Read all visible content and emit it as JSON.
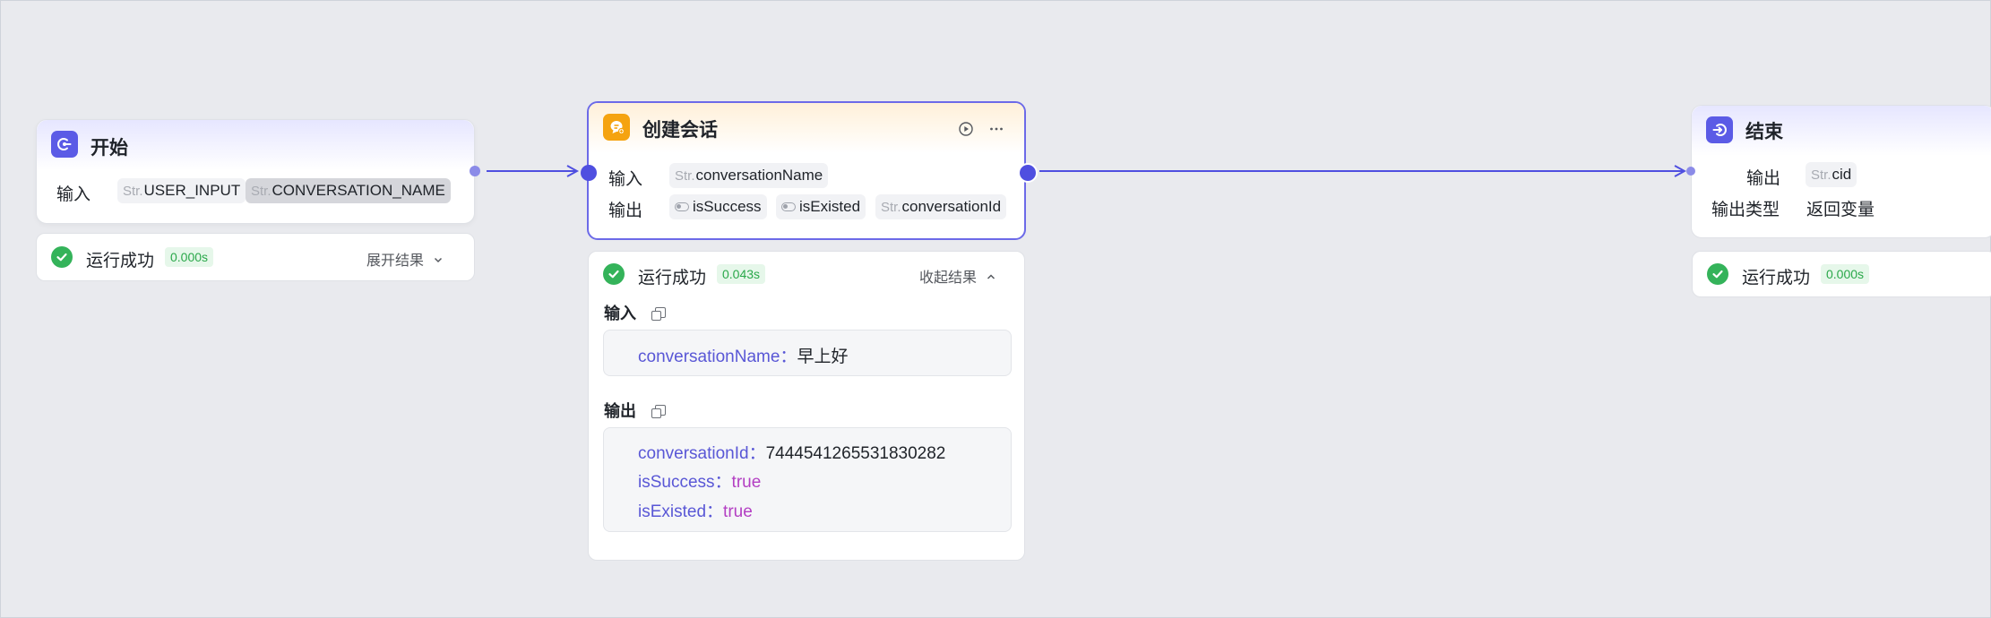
{
  "nodes": {
    "start": {
      "title": "开始",
      "input_label": "输入",
      "inputs": [
        {
          "prefix": "Str.",
          "name": "USER_INPUT"
        },
        {
          "prefix": "Str.",
          "name": "CONVERSATION_NAME"
        }
      ],
      "run": {
        "status": "运行成功",
        "time": "0.000s",
        "toggle": "展开结果"
      }
    },
    "create": {
      "title": "创建会话",
      "input_label": "输入",
      "output_label": "输出",
      "input_tag": {
        "prefix": "Str.",
        "name": "conversationName"
      },
      "outputs": [
        {
          "type": "bool",
          "name": "isSuccess"
        },
        {
          "type": "bool",
          "name": "isExisted"
        },
        {
          "prefix": "Str.",
          "name": "conversationId"
        }
      ],
      "run": {
        "status": "运行成功",
        "time": "0.043s",
        "toggle": "收起结果",
        "input_section": "输入",
        "output_section": "输出",
        "input_kv": {
          "key": "conversationName",
          "sep": "：",
          "value": "早上好"
        },
        "output_kv": [
          {
            "key": "conversationId",
            "sep": "：",
            "value": "7444541265531830282"
          },
          {
            "key": "isSuccess",
            "sep": "：",
            "value": "true"
          },
          {
            "key": "isExisted",
            "sep": "：",
            "value": "true"
          }
        ]
      }
    },
    "end": {
      "title": "结束",
      "output_label": "输出",
      "output_tag": {
        "prefix": "Str.",
        "name": "cid"
      },
      "type_label": "输出类型",
      "type_value": "返回变量",
      "run": {
        "status": "运行成功",
        "time": "0.000s"
      }
    }
  },
  "colors": {
    "canvas": "#e9eaee",
    "accent": "#5b5be6",
    "edge": "#4f4fe0",
    "success": "#34b35a",
    "key_text": "#5957d6",
    "bool_text": "#b33fc3",
    "llm_icon": "#f5a310"
  },
  "icons": {
    "start": "start-node-icon",
    "create": "create-conversation-icon",
    "end": "end-node-icon",
    "run": "play-circle-icon",
    "more": "more-icon",
    "success": "check-circle-icon",
    "copy": "copy-icon"
  }
}
